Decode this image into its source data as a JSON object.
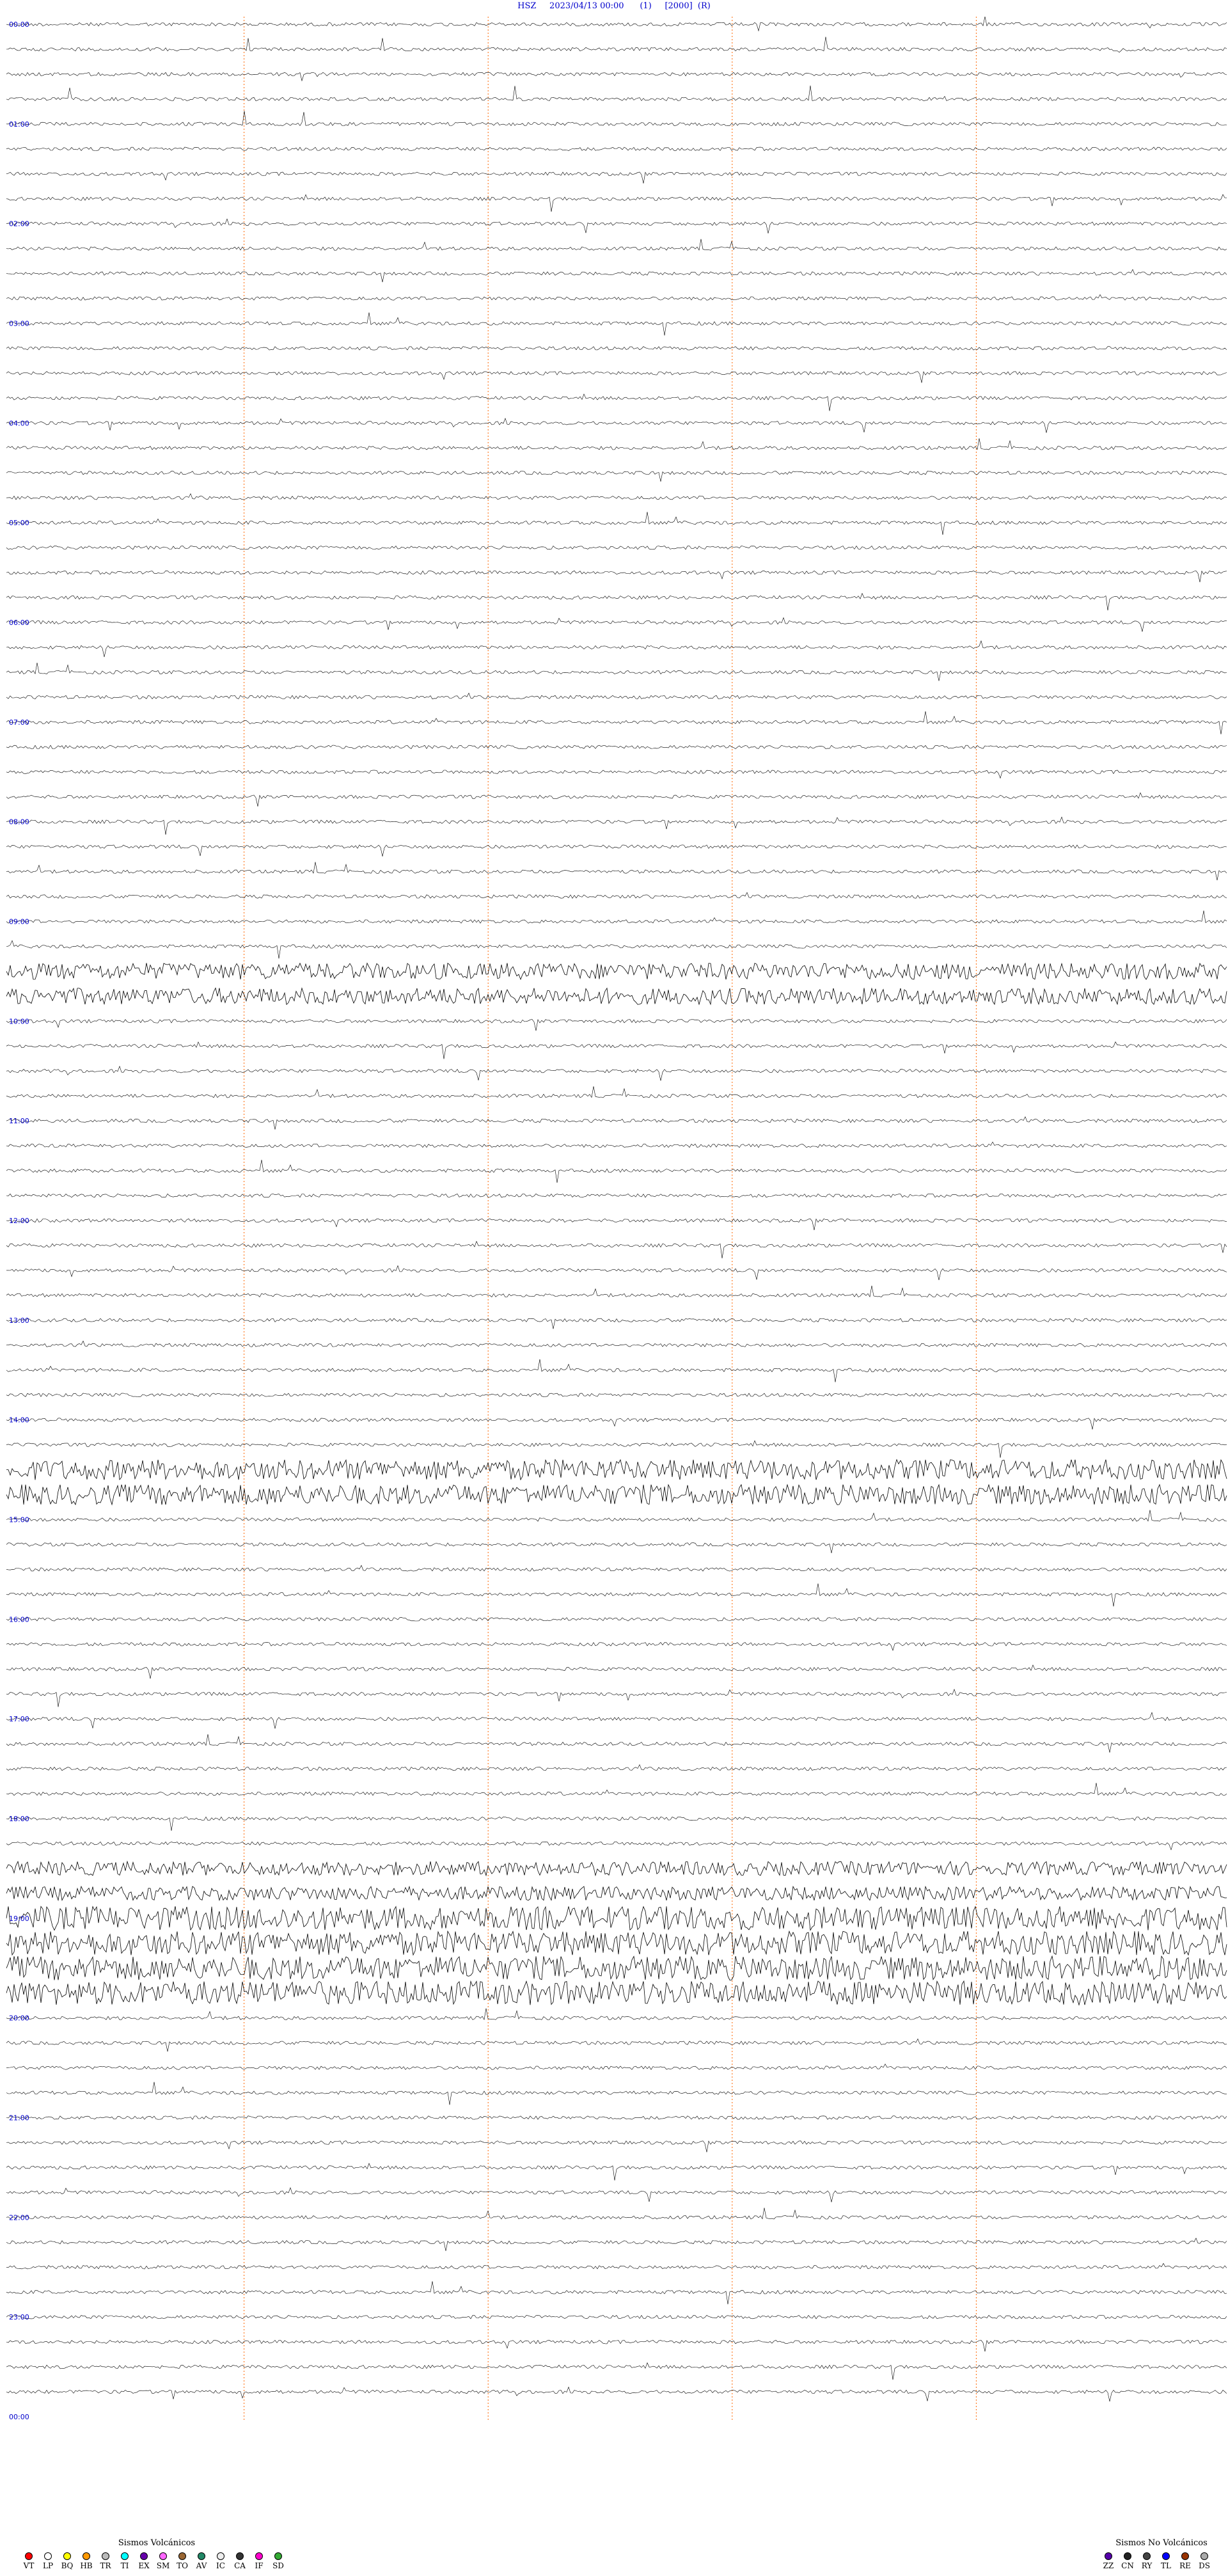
{
  "header": {
    "title": "HSZ     2023/04/13 00:00      (1)     [2000]  (R)"
  },
  "chart_data": {
    "type": "helicorder",
    "station": "HSZ",
    "date": "2023/04/13",
    "num_lines": 96,
    "minutes_per_line": 15,
    "hour_labels": [
      "00:00",
      "01:00",
      "02:00",
      "03:00",
      "04:00",
      "05:00",
      "06:00",
      "07:00",
      "08:00",
      "09:00",
      "10:00",
      "11:00",
      "12:00",
      "13:00",
      "14:00",
      "15:00",
      "16:00",
      "17:00",
      "18:00",
      "19:00",
      "20:00",
      "21:00",
      "22:00",
      "23:00",
      "00:00"
    ],
    "trace_color": "#000000",
    "label_color": "#0000cc",
    "minute_mark_color": "#ff6600",
    "heavy_bands": [
      {
        "from_line": 76,
        "to_line": 79,
        "level": 0.9
      },
      {
        "from_line": 74,
        "to_line": 75,
        "level": 0.5
      },
      {
        "from_line": 58,
        "to_line": 59,
        "level": 0.75
      },
      {
        "from_line": 38,
        "to_line": 39,
        "level": 0.6
      }
    ]
  },
  "legend": {
    "volcanic": {
      "title": "Sismos Volcánicos",
      "items": [
        {
          "label": "VT",
          "color": "#ff0000"
        },
        {
          "label": "LP",
          "color": "#ffffff"
        },
        {
          "label": "BQ",
          "color": "#ffff00"
        },
        {
          "label": "HB",
          "color": "#ff9900"
        },
        {
          "label": "TR",
          "color": "#bbbbbb"
        },
        {
          "label": "TI",
          "color": "#00ffff"
        },
        {
          "label": "EX",
          "color": "#6600aa"
        },
        {
          "label": "SM",
          "color": "#ff66ff"
        },
        {
          "label": "TO",
          "color": "#996633"
        },
        {
          "label": "AV",
          "color": "#228866"
        },
        {
          "label": "IC",
          "color": "#eeeeee"
        },
        {
          "label": "CA",
          "color": "#333333"
        },
        {
          "label": "IF",
          "color": "#ff00cc"
        },
        {
          "label": "SD",
          "color": "#33aa33"
        }
      ]
    },
    "non_volcanic": {
      "title": "Sismos No Volcánicos",
      "items": [
        {
          "label": "ZZ",
          "color": "#5500aa"
        },
        {
          "label": "CN",
          "color": "#222222"
        },
        {
          "label": "RY",
          "color": "#444444"
        },
        {
          "label": "TL",
          "color": "#0000ff"
        },
        {
          "label": "RE",
          "color": "#993300"
        },
        {
          "label": "DS",
          "color": "#aaaaaa"
        }
      ]
    }
  }
}
